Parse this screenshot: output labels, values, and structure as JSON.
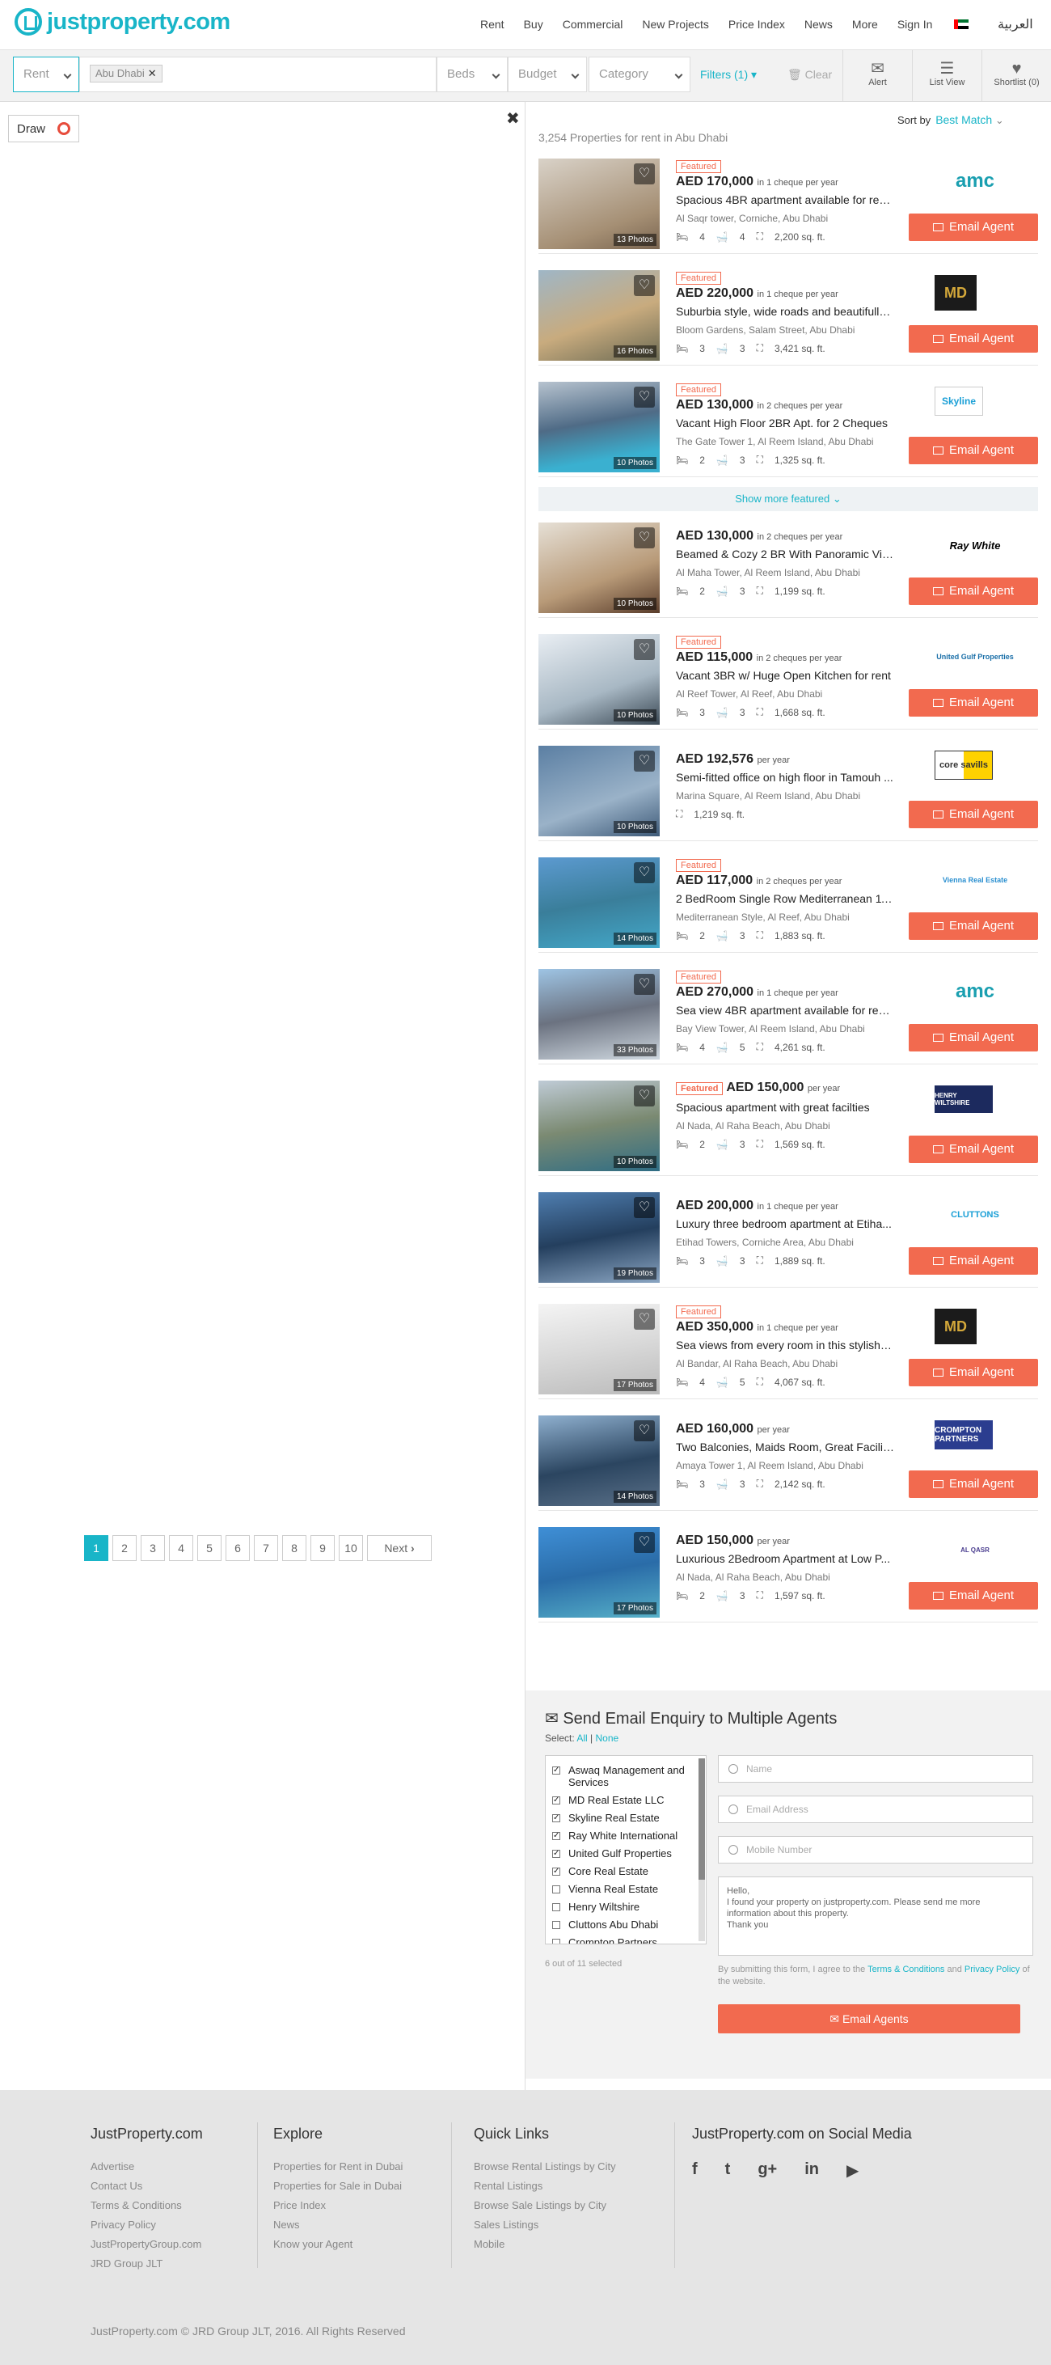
{
  "header": {
    "logo": "justproperty.com",
    "menu": [
      "Rent",
      "Buy",
      "Commercial",
      "New Projects",
      "Price Index",
      "News",
      "More",
      "Sign In"
    ],
    "language": "العربية"
  },
  "filters": {
    "purpose": "Rent",
    "location_tag": "Abu Dhabi",
    "beds": "Beds",
    "budget": "Budget",
    "category": "Category",
    "filters_link": "Filters (1)",
    "clear": "Clear",
    "alert": "Alert",
    "list_view": "List View",
    "shortlist": "Shortlist (0)"
  },
  "map": {
    "draw": "Draw"
  },
  "results": {
    "count": "3,254 Properties for rent in Abu Dhabi",
    "sort_label": "Sort by",
    "sort_value": "Best Match",
    "featured_label": "Featured",
    "email_label": "Email Agent",
    "show_more": "Show more featured"
  },
  "listings": [
    {
      "featured": true,
      "price": "AED 170,000",
      "ptype": "in 1 cheque per year",
      "title": "Spacious 4BR apartment available for ren...",
      "location": "Al Saqr tower, Corniche, Abu Dhabi",
      "beds": "4",
      "baths": "4",
      "area": "2,200 sq. ft.",
      "photos": "13 Photos",
      "agent": "amc"
    },
    {
      "featured": true,
      "price": "AED 220,000",
      "ptype": "in 1 cheque per year",
      "title": "Suburbia style, wide roads and beautifully ...",
      "location": "Bloom Gardens, Salam Street, Abu Dhabi",
      "beds": "3",
      "baths": "3",
      "area": "3,421 sq. ft.",
      "photos": "16 Photos",
      "agent": "MD"
    },
    {
      "featured": true,
      "price": "AED 130,000",
      "ptype": "in 2 cheques per year",
      "title": "Vacant High Floor 2BR Apt. for 2 Cheques",
      "location": "The Gate Tower 1, Al Reem Island, Abu Dhabi",
      "beds": "2",
      "baths": "3",
      "area": "1,325 sq. ft.",
      "photos": "10 Photos",
      "agent": "Skyline"
    },
    {
      "featured": false,
      "price": "AED 130,000",
      "ptype": "in 2 cheques per year",
      "title": "Beamed & Cozy 2 BR With Panoramic View",
      "location": "Al Maha Tower, Al Reem Island, Abu Dhabi",
      "beds": "2",
      "baths": "3",
      "area": "1,199 sq. ft.",
      "photos": "10 Photos",
      "agent": "Ray White"
    },
    {
      "featured": true,
      "price": "AED 115,000",
      "ptype": "in 2 cheques per year",
      "title": "Vacant 3BR w/ Huge Open Kitchen for rent",
      "location": "Al Reef Tower, Al Reef, Abu Dhabi",
      "beds": "3",
      "baths": "3",
      "area": "1,668 sq. ft.",
      "photos": "10 Photos",
      "agent": "United Gulf Properties"
    },
    {
      "featured": false,
      "price": "AED 192,576",
      "ptype": "per year",
      "title": "Semi-fitted office on high floor in Tamouh ...",
      "location": "Marina Square, Al Reem Island, Abu Dhabi",
      "beds": "",
      "baths": "",
      "area": "1,219 sq. ft.",
      "photos": "10 Photos",
      "agent": "core savills"
    },
    {
      "featured": true,
      "price": "AED 117,000",
      "ptype": "in 2 cheques per year",
      "title": "2 BedRoom Single Row Mediterranean 11...",
      "location": "Mediterranean Style, Al Reef, Abu Dhabi",
      "beds": "2",
      "baths": "3",
      "area": "1,883 sq. ft.",
      "photos": "14 Photos",
      "agent": "Vienna Real Estate"
    },
    {
      "featured": true,
      "price": "AED 270,000",
      "ptype": "in 1 cheque per year",
      "title": "Sea view 4BR apartment available for rent...",
      "location": "Bay View Tower, Al Reem Island, Abu Dhabi",
      "beds": "4",
      "baths": "5",
      "area": "4,261 sq. ft.",
      "photos": "33 Photos",
      "agent": "amc"
    },
    {
      "featured": true,
      "price": "AED 150,000",
      "ptype": "per year",
      "title": "Spacious apartment with great facilties",
      "location": "Al Nada, Al Raha Beach, Abu Dhabi",
      "beds": "2",
      "baths": "3",
      "area": "1,569 sq. ft.",
      "photos": "10 Photos",
      "agent": "HENRY WILTSHIRE"
    },
    {
      "featured": false,
      "price": "AED 200,000",
      "ptype": "in 1 cheque per year",
      "title": "Luxury three bedroom apartment at Etiha...",
      "location": "Etihad Towers, Corniche Area, Abu Dhabi",
      "beds": "3",
      "baths": "3",
      "area": "1,889 sq. ft.",
      "photos": "19 Photos",
      "agent": "CLUTTONS"
    },
    {
      "featured": true,
      "price": "AED 350,000",
      "ptype": "in 1 cheque per year",
      "title": "Sea views from every room in this stylish a...",
      "location": "Al Bandar, Al Raha Beach, Abu Dhabi",
      "beds": "4",
      "baths": "5",
      "area": "4,067 sq. ft.",
      "photos": "17 Photos",
      "agent": "MD"
    },
    {
      "featured": false,
      "price": "AED 160,000",
      "ptype": "per year",
      "title": "Two Balconies, Maids Room, Great Facilities",
      "location": "Amaya Tower 1, Al Reem Island, Abu Dhabi",
      "beds": "3",
      "baths": "3",
      "area": "2,142 sq. ft.",
      "photos": "14 Photos",
      "agent": "CROMPTON PARTNERS"
    },
    {
      "featured": false,
      "price": "AED 150,000",
      "ptype": "per year",
      "title": "Luxurious 2Bedroom Apartment at Low P...",
      "location": "Al Nada, Al Raha Beach, Abu Dhabi",
      "beds": "2",
      "baths": "3",
      "area": "1,597 sq. ft.",
      "photos": "17 Photos",
      "agent": "AL QASR"
    }
  ],
  "pagination": {
    "pages": [
      "1",
      "2",
      "3",
      "4",
      "5",
      "6",
      "7",
      "8",
      "9",
      "10"
    ],
    "next": "Next"
  },
  "enquiry": {
    "title": "Send Email Enquiry to Multiple Agents",
    "select_label": "Select:",
    "all": "All",
    "none": "None",
    "agents": [
      {
        "name": "Aswaq Management and Services",
        "checked": true
      },
      {
        "name": "MD Real Estate LLC",
        "checked": true
      },
      {
        "name": "Skyline Real Estate",
        "checked": true
      },
      {
        "name": "Ray White International",
        "checked": true
      },
      {
        "name": "United Gulf Properties",
        "checked": true
      },
      {
        "name": "Core Real Estate",
        "checked": true
      },
      {
        "name": "Vienna Real Estate",
        "checked": false
      },
      {
        "name": "Henry Wiltshire",
        "checked": false
      },
      {
        "name": "Cluttons Abu Dhabi",
        "checked": false
      },
      {
        "name": "Crompton Partners",
        "checked": false
      }
    ],
    "selected_count": "6 out of 11 selected",
    "name_ph": "Name",
    "email_ph": "Email Address",
    "mobile_ph": "Mobile Number",
    "message": "Hello,\nI found your property on justproperty.com. Please send me more information about this property.\nThank you",
    "terms_pre": "By submitting this form, I agree to the",
    "terms_link": "Terms & Conditions",
    "terms_and": "and",
    "privacy_link": "Privacy Policy",
    "terms_post": "of the website.",
    "submit": "Email Agents"
  },
  "footer": {
    "col1": {
      "title": "JustProperty.com",
      "links": [
        "Advertise",
        "Contact Us",
        "Terms & Conditions",
        "Privacy Policy",
        "JustPropertyGroup.com",
        "JRD Group JLT"
      ]
    },
    "col2": {
      "title": "Explore",
      "links": [
        "Properties for Rent in Dubai",
        "Properties for Sale in Dubai",
        "Price Index",
        "News",
        "Know your Agent"
      ]
    },
    "col3": {
      "title": "Quick Links",
      "links": [
        "Browse Rental Listings by City",
        "Rental Listings",
        "Browse Sale Listings by City",
        "Sales Listings",
        "Mobile"
      ]
    },
    "col4": {
      "title": "JustProperty.com on Social Media",
      "icons": [
        "f",
        "t",
        "g+",
        "in",
        "yt"
      ]
    },
    "copyright": "JustProperty.com © JRD Group JLT, 2016. All Rights Reserved"
  }
}
